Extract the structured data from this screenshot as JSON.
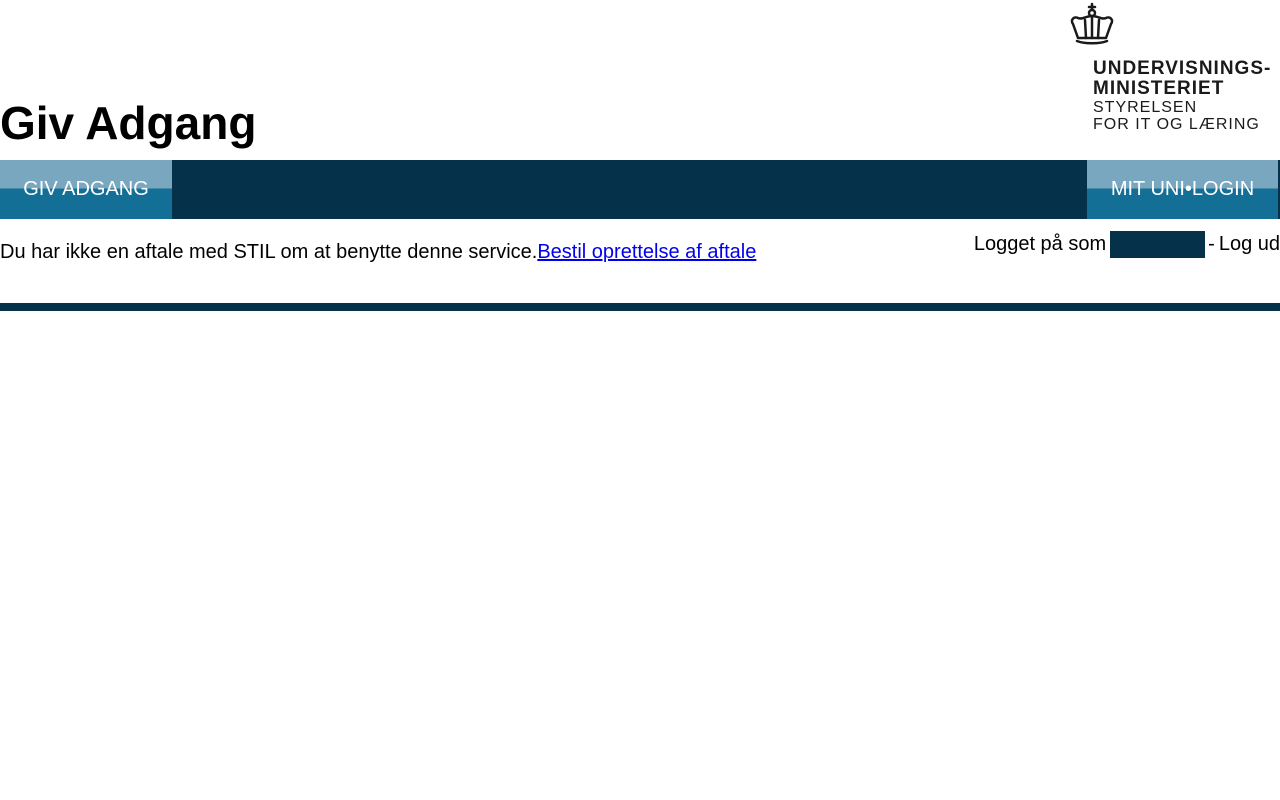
{
  "header": {
    "title": "Giv Adgang",
    "logo": {
      "icon": "crown-icon",
      "lines": [
        "UNDERVISNINGS-",
        "MINISTERIET",
        "STYRELSEN",
        "FOR IT OG LÆRING"
      ]
    }
  },
  "nav": {
    "left_label": "GIV ADGANG",
    "right_label": "MIT UNI•LOGIN"
  },
  "notice": {
    "text": "Du har ikke en aftale med STIL om at benytte denne service.",
    "link_text": "Bestil oprettelse af aftale"
  },
  "login": {
    "prefix": "Logget på som",
    "username": "",
    "separator": "-",
    "logout_label": "Log ud"
  },
  "colors": {
    "navy": "#05324a",
    "button_top": "#7aa7c0",
    "button_bottom": "#136f95",
    "link": "#0000ee"
  }
}
